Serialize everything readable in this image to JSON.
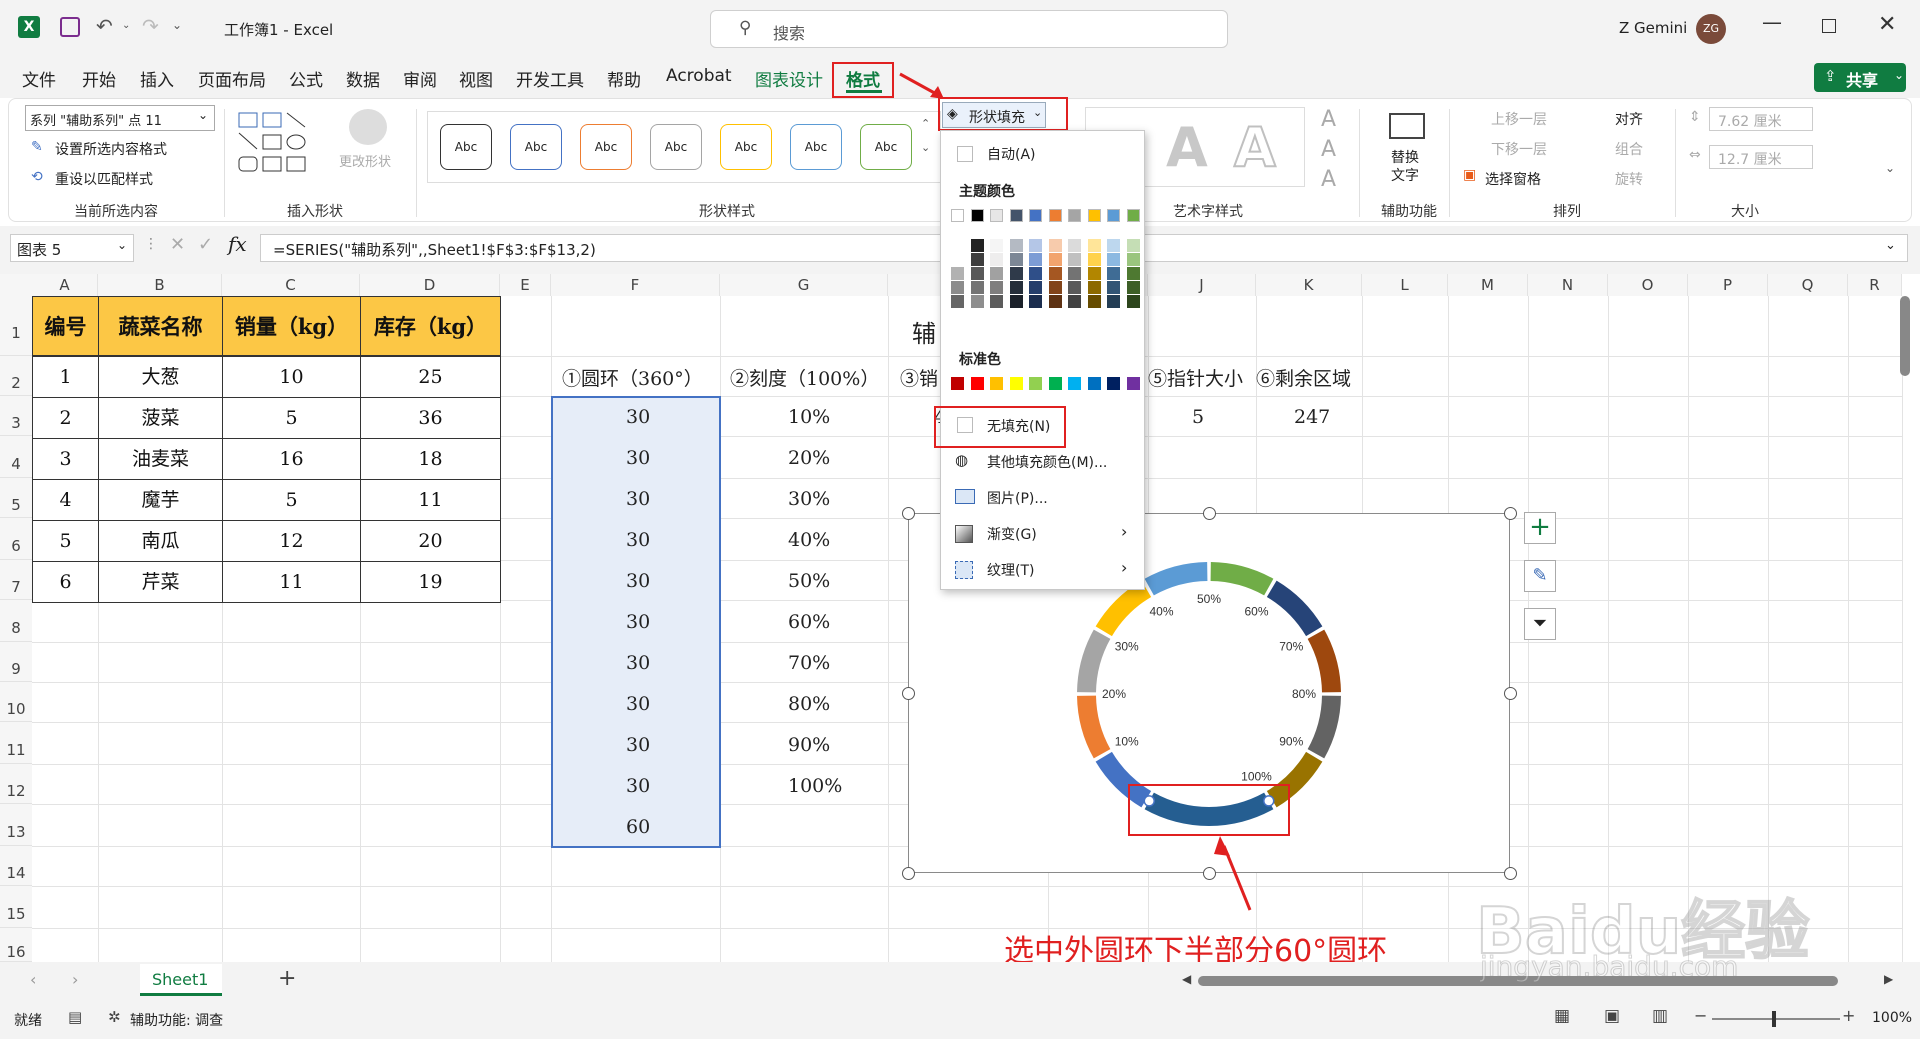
{
  "window": {
    "title": "工作簿1  -  Excel",
    "search_placeholder": "搜索",
    "user_name": "Z Gemini",
    "user_initials": "ZG"
  },
  "tabs": [
    "文件",
    "开始",
    "插入",
    "页面布局",
    "公式",
    "数据",
    "审阅",
    "视图",
    "开发工具",
    "帮助",
    "Acrobat",
    "图表设计",
    "格式"
  ],
  "share_label": "共享",
  "ribbon": {
    "current_selection": {
      "dropdown_value": "系列 \"辅助系列\" 点 11",
      "format_selection": "设置所选内容格式",
      "reset_style": "重设以匹配样式",
      "label": "当前所选内容"
    },
    "insert_shapes": {
      "change_shape": "更改形状",
      "label": "插入形状"
    },
    "shape_styles": {
      "swatch_text": "Abc",
      "label": "形状样式",
      "fill_button": "形状填充",
      "swatch_colors": [
        "#333333",
        "#4472c4",
        "#ed7d31",
        "#a5a5a5",
        "#ffc000",
        "#5b9bd5",
        "#70ad47"
      ]
    },
    "wordart": {
      "label": "艺术字样式",
      "letter": "A"
    },
    "accessibility": {
      "alt_text_line1": "替换",
      "alt_text_line2": "文字",
      "label": "辅助功能"
    },
    "arrange": {
      "bring_forward": "上移一层",
      "send_backward": "下移一层",
      "selection_pane": "选择窗格",
      "align": "对齐",
      "group": "组合",
      "rotate": "旋转",
      "label": "排列"
    },
    "size": {
      "height": "7.62 厘米",
      "width": "12.7 厘米",
      "label": "大小"
    }
  },
  "formula_bar": {
    "name_box": "图表 5",
    "fx": "fx",
    "formula": "=SERIES(\"辅助系列\",,Sheet1!$F$3:$F$13,2)"
  },
  "columns": [
    "A",
    "B",
    "C",
    "D",
    "E",
    "F",
    "G",
    "H",
    "I",
    "J",
    "K",
    "L",
    "M",
    "N",
    "O",
    "P",
    "Q",
    "R"
  ],
  "rows": [
    "1",
    "2",
    "3",
    "4",
    "5",
    "6",
    "7",
    "8",
    "9",
    "10",
    "11",
    "12",
    "13",
    "14",
    "15",
    "16"
  ],
  "table": {
    "headers": [
      "编号",
      "蔬菜名称",
      "销量（kg）",
      "库存（kg）"
    ],
    "rows": [
      [
        "1",
        "大葱",
        "10",
        "25"
      ],
      [
        "2",
        "菠菜",
        "5",
        "36"
      ],
      [
        "3",
        "油麦菜",
        "16",
        "18"
      ],
      [
        "4",
        "魔芋",
        "5",
        "11"
      ],
      [
        "5",
        "南瓜",
        "12",
        "20"
      ],
      [
        "6",
        "芹菜",
        "11",
        "19"
      ]
    ]
  },
  "aux": {
    "chart_title_partial": "辅",
    "f_header": "①圆环（360°）",
    "g_header": "②刻度（100%）",
    "h_header_partial": "③销",
    "j_header": "⑤指针大小",
    "k_header": "⑥剩余区域",
    "f_values": [
      "30",
      "30",
      "30",
      "30",
      "30",
      "30",
      "30",
      "30",
      "30",
      "30",
      "60"
    ],
    "g_values": [
      "10%",
      "20%",
      "30%",
      "40%",
      "50%",
      "60%",
      "70%",
      "80%",
      "90%",
      "100%"
    ],
    "h3_partial": "4",
    "j3": "5",
    "k3": "247"
  },
  "fill_menu": {
    "auto": "自动(A)",
    "theme_colors": "主题颜色",
    "standard_colors": "标准色",
    "no_fill": "无填充(N)",
    "more_colors": "其他填充颜色(M)...",
    "picture": "图片(P)...",
    "gradient": "渐变(G)",
    "texture": "纹理(T)",
    "theme_row": [
      "#ffffff",
      "#000000",
      "#e7e6e6",
      "#44546a",
      "#4472c4",
      "#ed7d31",
      "#a5a5a5",
      "#ffc000",
      "#5b9bd5",
      "#70ad47"
    ],
    "standard_row": [
      "#c00000",
      "#ff0000",
      "#ffc000",
      "#ffff00",
      "#92d050",
      "#00b050",
      "#00b0f0",
      "#0070c0",
      "#002060",
      "#7030a0"
    ]
  },
  "chart_data": {
    "type": "pie",
    "categories": [
      "10%",
      "20%",
      "30%",
      "40%",
      "50%",
      "60%",
      "70%",
      "80%",
      "90%",
      "100%"
    ],
    "values": [
      30,
      30,
      30,
      30,
      30,
      30,
      30,
      30,
      30,
      30,
      60
    ],
    "colors": [
      "#4472c4",
      "#ed7d31",
      "#a5a5a5",
      "#ffc000",
      "#5b9bd5",
      "#70ad47",
      "#264478",
      "#9e480e",
      "#636363",
      "#997300",
      "#255e91"
    ],
    "title": "",
    "donut": true
  },
  "annotation": "选中外圆环下半部分60°圆环",
  "sheet_tab": "Sheet1",
  "status": {
    "ready": "就绪",
    "accessibility": "辅助功能: 调查",
    "zoom": "100%"
  },
  "watermark": {
    "brand": "Baidu经验",
    "url": "jingyan.baidu.com"
  }
}
